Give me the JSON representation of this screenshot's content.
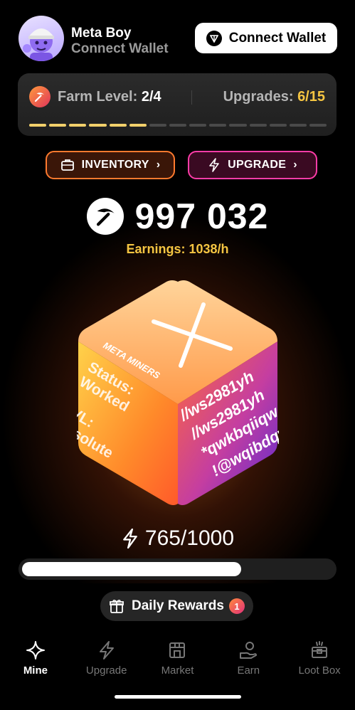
{
  "user": {
    "name": "Meta Boy",
    "subtitle": "Connect Wallet"
  },
  "wallet_button": {
    "label": "Connect Wallet"
  },
  "farm": {
    "level_label": "Farm Level: ",
    "level_value": "2/4",
    "upgrades_label": "Upgrades: ",
    "upgrades_value": "6/15",
    "segments_total": 15,
    "segments_filled": 6
  },
  "actions": {
    "inventory_label": "INVENTORY",
    "upgrade_label": "UPGRADE"
  },
  "balance": {
    "amount": "997 032",
    "earnings": "Earnings: 1038/h"
  },
  "cube": {
    "brand": "META MINERS",
    "status_label": "Status:",
    "status_value": "Worked",
    "lvl_label": "LVL:",
    "lvl_value": "Absolute",
    "codes": [
      "//ws2981yh",
      "//ws2981yh",
      "*qwkbqiiqw",
      "!@wqibdqw"
    ]
  },
  "energy": {
    "text": "765/1000",
    "fraction": 0.765
  },
  "daily_rewards": {
    "label": "Daily Rewards",
    "badge": "1"
  },
  "nav": {
    "items": [
      {
        "label": "Mine",
        "icon": "sparkle-icon",
        "active": true
      },
      {
        "label": "Upgrade",
        "icon": "lightning-icon",
        "active": false
      },
      {
        "label": "Market",
        "icon": "store-icon",
        "active": false
      },
      {
        "label": "Earn",
        "icon": "hand-coin-icon",
        "active": false
      },
      {
        "label": "Loot Box",
        "icon": "loot-box-icon",
        "active": false
      }
    ]
  },
  "colors": {
    "accent_orange": "#ff7a2e",
    "accent_pink": "#ff3ca8",
    "gold": "#f5c542",
    "progress_on": "#f2d06b"
  }
}
